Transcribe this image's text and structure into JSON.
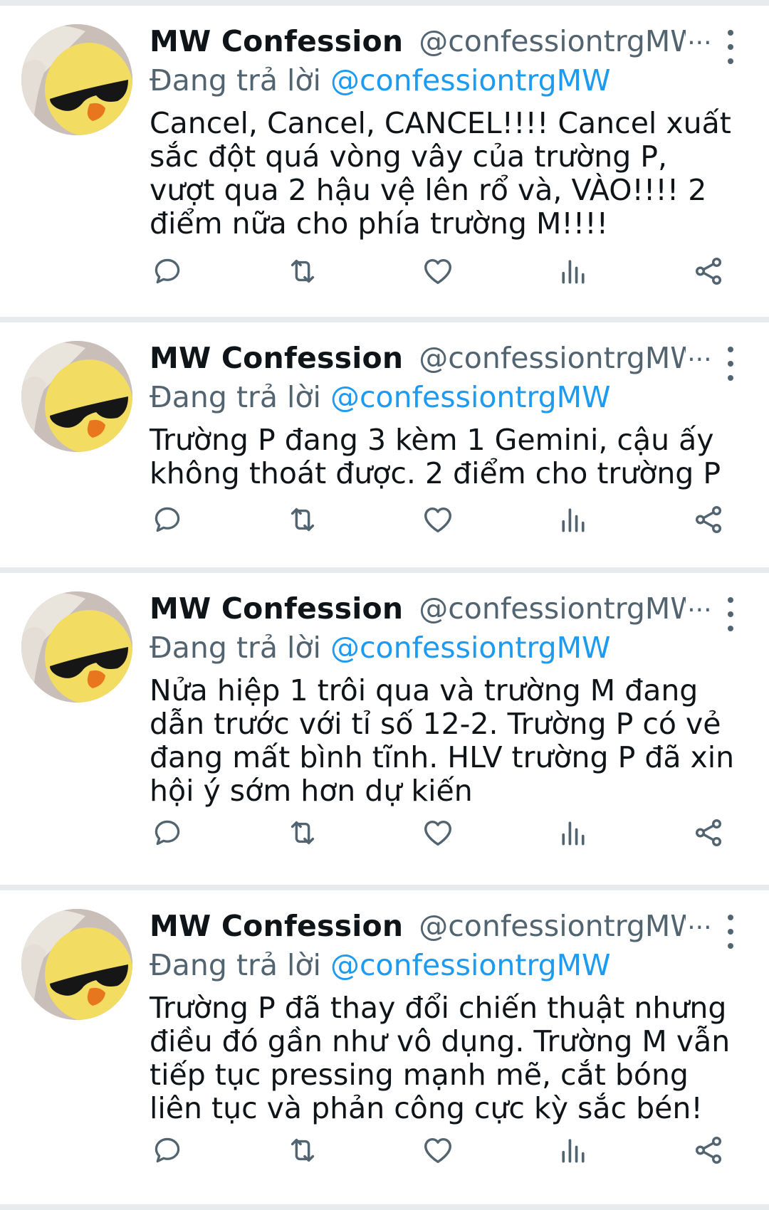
{
  "accent_color": "#1d9bf0",
  "secondary_text_color": "#536471",
  "tweets": [
    {
      "author_name": "MW Confession",
      "author_handle": "@confessiontrgMW",
      "handle_ellipsis": "···",
      "reply_prefix": "Đang trả lời",
      "reply_to": "@confessiontrgMW",
      "text": "Cancel, Cancel, CANCEL!!!! Cancel xuất sắc đột quá vòng vây của trường P, vượt qua 2 hậu vệ lên rổ và, VÀO!!!! 2 điểm nữa cho phía trường M!!!!"
    },
    {
      "author_name": "MW Confession",
      "author_handle": "@confessiontrgMW",
      "handle_ellipsis": "···",
      "reply_prefix": "Đang trả lời",
      "reply_to": "@confessiontrgMW",
      "text": "Trường P đang 3 kèm 1 Gemini, cậu ấy không thoát được. 2 điểm cho trường P"
    },
    {
      "author_name": "MW Confession",
      "author_handle": "@confessiontrgMW",
      "handle_ellipsis": "···",
      "reply_prefix": "Đang trả lời",
      "reply_to": "@confessiontrgMW",
      "text": "Nửa hiệp 1 trôi qua và trường M đang dẫn trước với tỉ số 12-2. Trường P có vẻ đang mất bình tĩnh. HLV trường P đã xin hội ý sớm hơn dự kiến"
    },
    {
      "author_name": "MW Confession",
      "author_handle": "@confessiontrgMW",
      "handle_ellipsis": "···",
      "reply_prefix": "Đang trả lời",
      "reply_to": "@confessiontrgMW",
      "text": "Trường P đã thay đổi chiến thuật nhưng điều đó gần như vô dụng. Trường M vẫn tiếp tục pressing mạnh mẽ, cắt bóng liên tục và phản công cực kỳ sắc bén!"
    }
  ],
  "action_icons": [
    "reply-icon",
    "retweet-icon",
    "like-icon",
    "analytics-icon",
    "share-icon"
  ]
}
